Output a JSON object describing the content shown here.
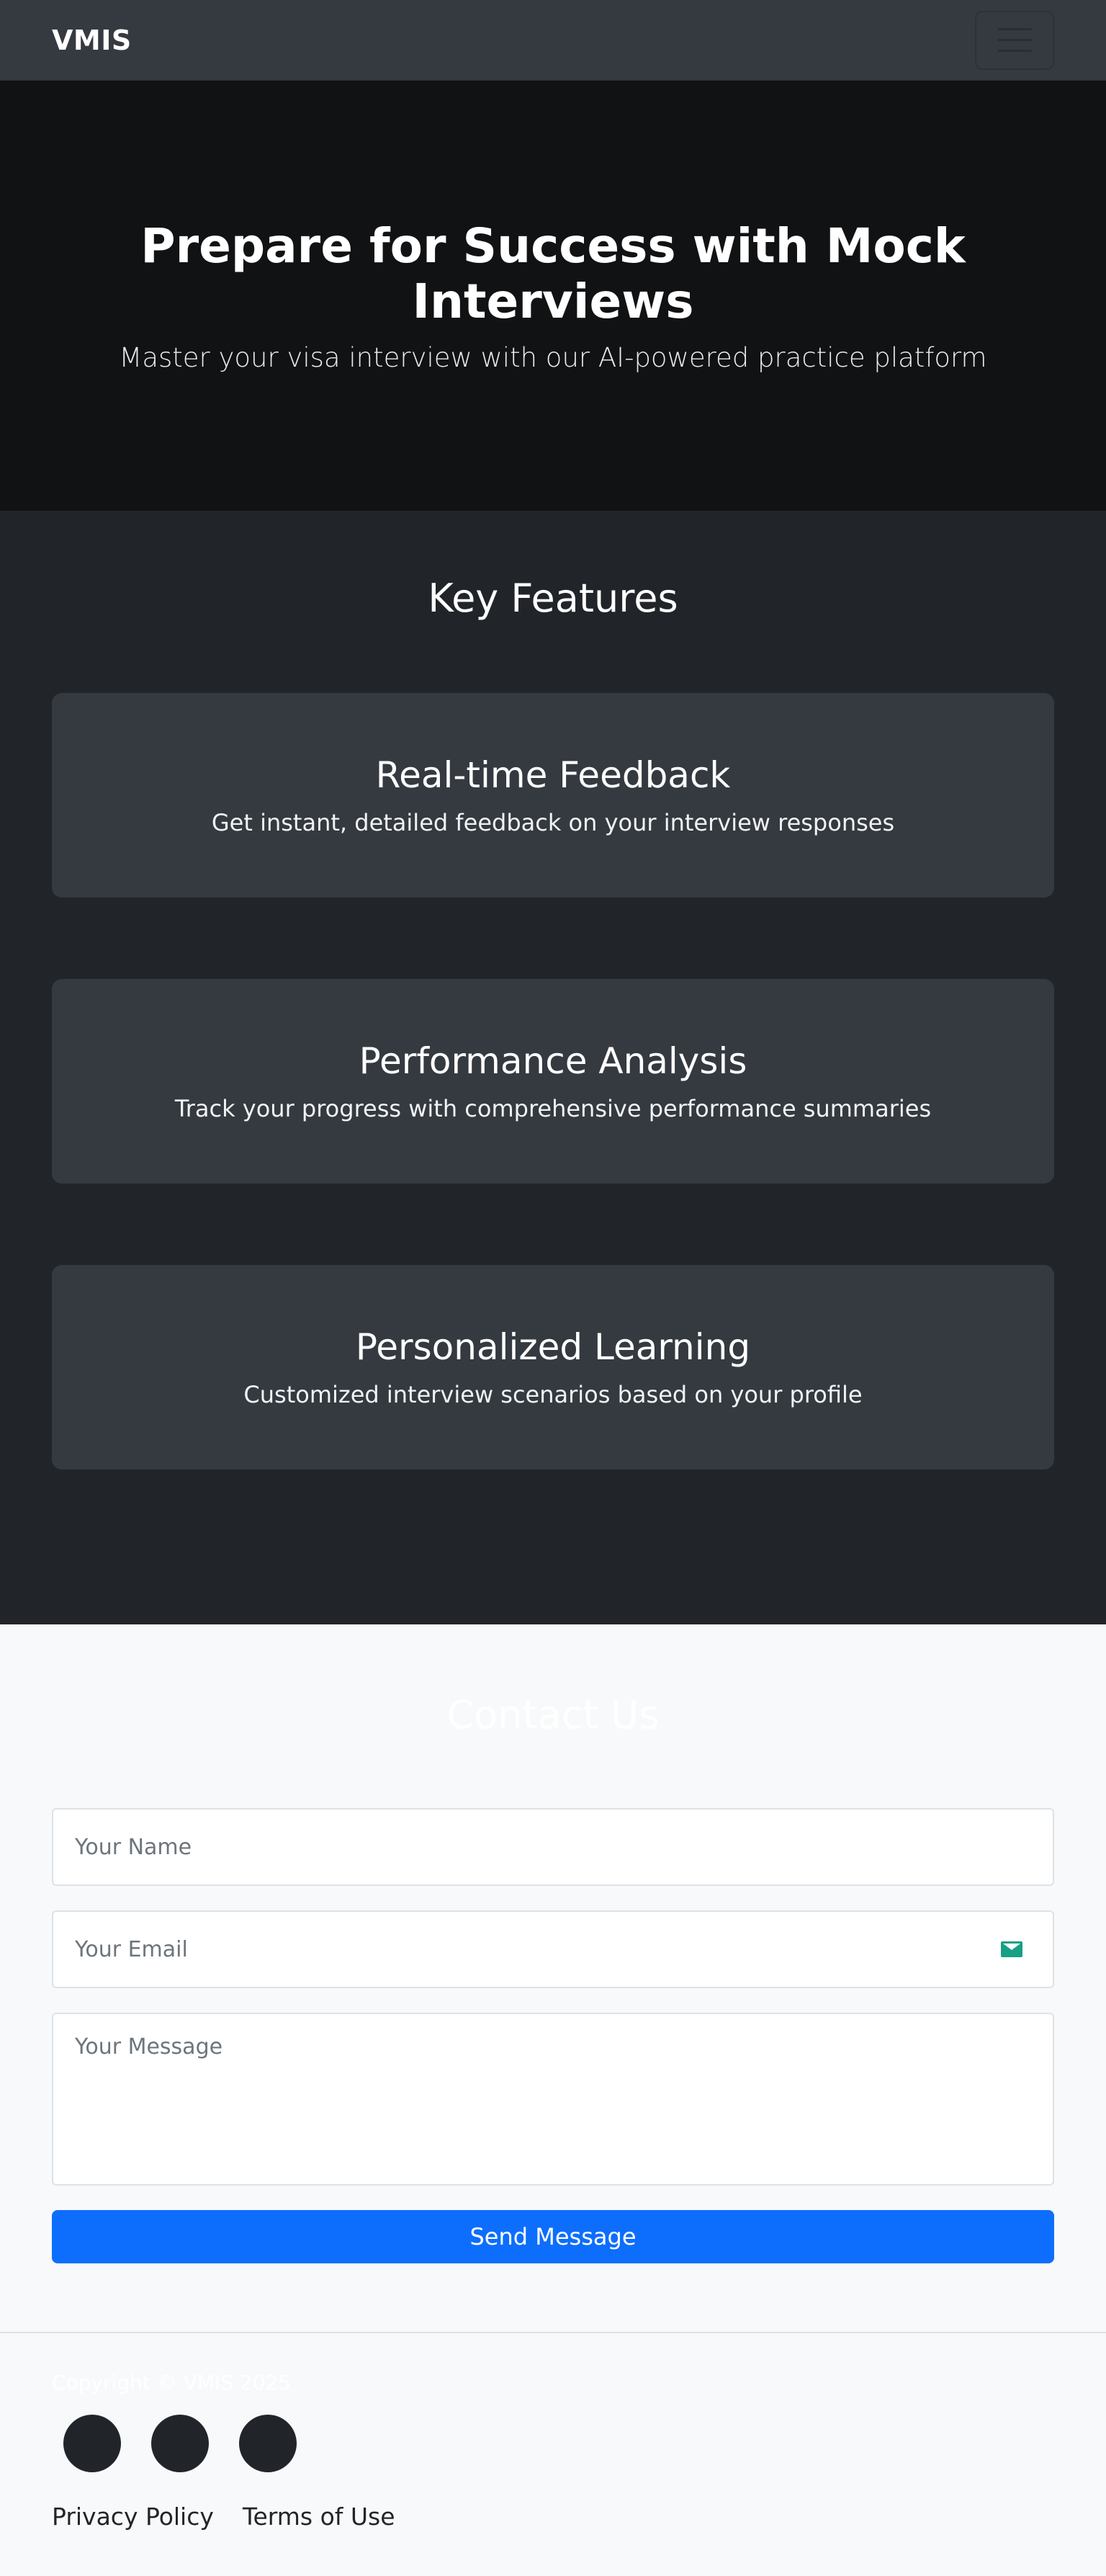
{
  "navbar": {
    "brand": "VMIS"
  },
  "hero": {
    "title": "Prepare for Success with Mock Interviews",
    "subtitle": "Master your visa interview with our AI-powered practice platform"
  },
  "features": {
    "heading": "Key Features",
    "items": [
      {
        "title": "Real-time Feedback",
        "description": "Get instant, detailed feedback on your interview responses"
      },
      {
        "title": "Performance Analysis",
        "description": "Track your progress with comprehensive performance summaries"
      },
      {
        "title": "Personalized Learning",
        "description": "Customized interview scenarios based on your profile"
      }
    ]
  },
  "contact": {
    "heading": "Contact Us",
    "name_placeholder": "Your Name",
    "email_placeholder": "Your Email",
    "message_placeholder": "Your Message",
    "submit_label": "Send Message",
    "email_icon": "mail-icon"
  },
  "footer": {
    "copyright": "Copyright © VMIS 2025",
    "links": [
      "Privacy Policy",
      "Terms of Use"
    ]
  }
}
